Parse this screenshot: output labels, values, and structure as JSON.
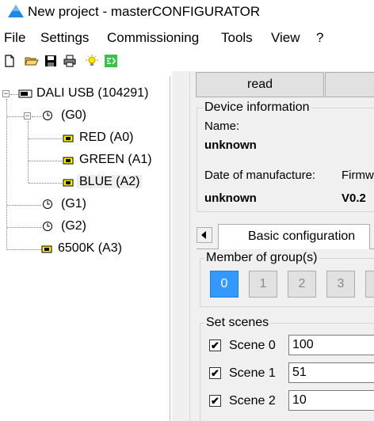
{
  "window": {
    "title": "New project - masterCONFIGURATOR"
  },
  "menu": [
    "File",
    "Settings",
    "Commissioning",
    "Tools",
    "View",
    "?"
  ],
  "toolbar": [
    "new-file",
    "open-folder",
    "save",
    "print",
    "light-bulb",
    "commission"
  ],
  "tree": {
    "root": "DALI USB (104291)",
    "groups": [
      {
        "label": "(G0)",
        "devices": [
          "RED (A0)",
          "GREEN (A1)",
          "BLUE (A2)"
        ]
      },
      {
        "label": "(G1)",
        "devices": []
      },
      {
        "label": "(G2)",
        "devices": []
      }
    ],
    "extra_device": "6500K (A3)",
    "selected": "BLUE (A2)"
  },
  "read_button": "read",
  "device_info": {
    "caption": "Device information",
    "name_label": "Name:",
    "name_value": "unknown",
    "date_label": "Date of manufacture:",
    "date_value": "unknown",
    "firmware_label": "Firmw",
    "firmware_value": "V0.2"
  },
  "tabs": {
    "active": "Basic configuration"
  },
  "member_of_groups": {
    "caption": "Member of group(s)",
    "buttons": [
      "0",
      "1",
      "2",
      "3"
    ],
    "active": "0"
  },
  "set_scenes": {
    "caption": "Set scenes",
    "scenes": [
      {
        "label": "Scene 0",
        "value": "100",
        "checked": true
      },
      {
        "label": "Scene 1",
        "value": "51",
        "checked": true
      },
      {
        "label": "Scene 2",
        "value": "10",
        "checked": true
      }
    ]
  },
  "colors": {
    "accent": "#3399ff",
    "window_bg": "#f0f0f0",
    "button_bg": "#e1e1e1"
  }
}
